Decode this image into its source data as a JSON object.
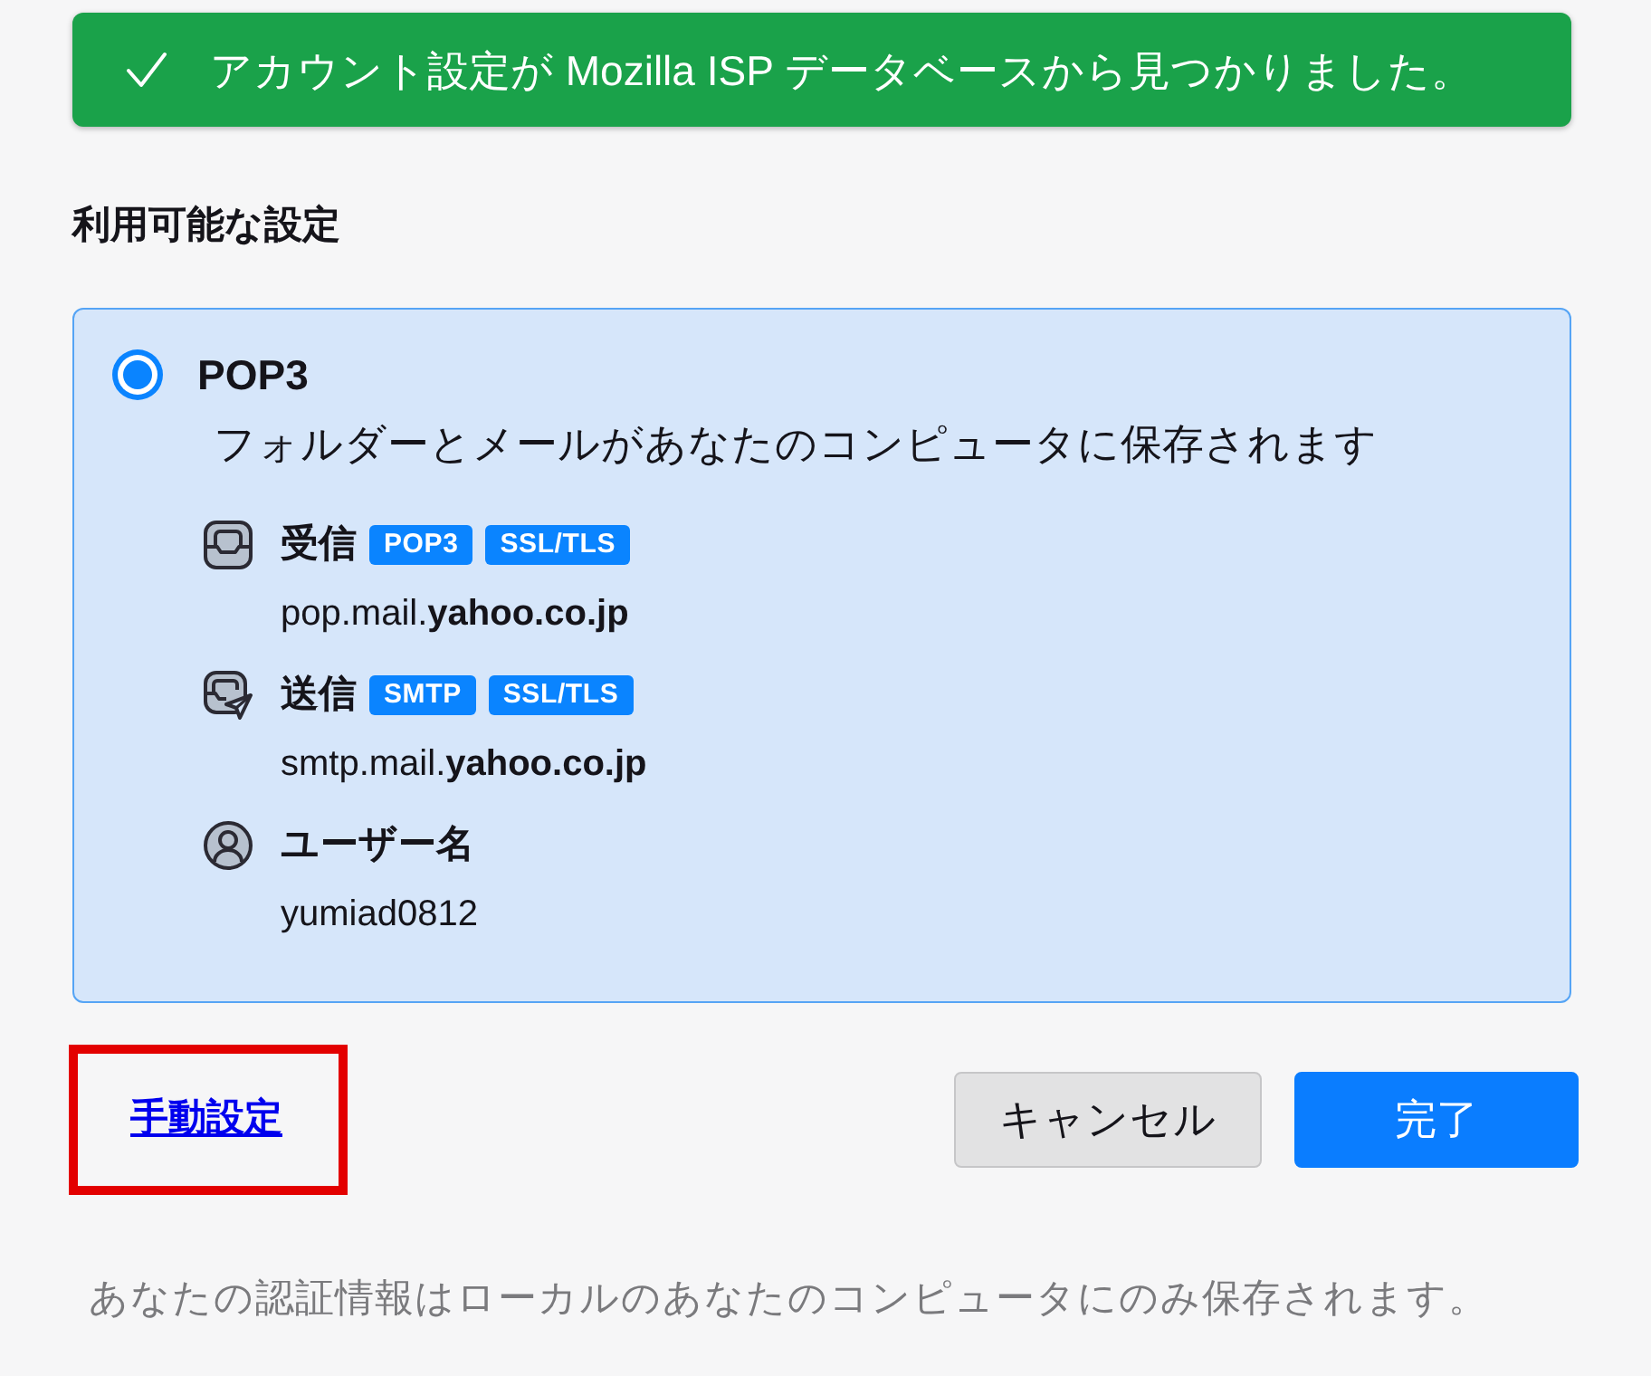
{
  "banner": {
    "kind": "success",
    "text": "アカウント設定が Mozilla ISP データベースから見つかりました。"
  },
  "section_heading": "利用可能な設定",
  "configs": [
    {
      "name": "POP3",
      "selected": true,
      "description": "フォルダーとメールがあなたのコンピュータに保存されます",
      "details": [
        {
          "kind": "incoming",
          "label": "受信",
          "tags": [
            "POP3",
            "SSL/TLS"
          ],
          "value": "pop.mail.**yahoo.co.jp**"
        },
        {
          "kind": "outgoing",
          "label": "送信",
          "tags": [
            "SMTP",
            "SSL/TLS"
          ],
          "value": "smtp.mail.**yahoo.co.jp**"
        },
        {
          "kind": "user",
          "label": "ユーザー名",
          "value": "yumiad0812"
        }
      ]
    }
  ],
  "manual_link": {
    "text": "手動設定",
    "highlighted": true
  },
  "buttons": [
    {
      "kind": "secondary",
      "label": "キャンセル"
    },
    {
      "kind": "primary",
      "label": "完了"
    }
  ],
  "footer_note": "あなたの認証情報はローカルのあなたのコンピュータにのみ保存されます。"
}
